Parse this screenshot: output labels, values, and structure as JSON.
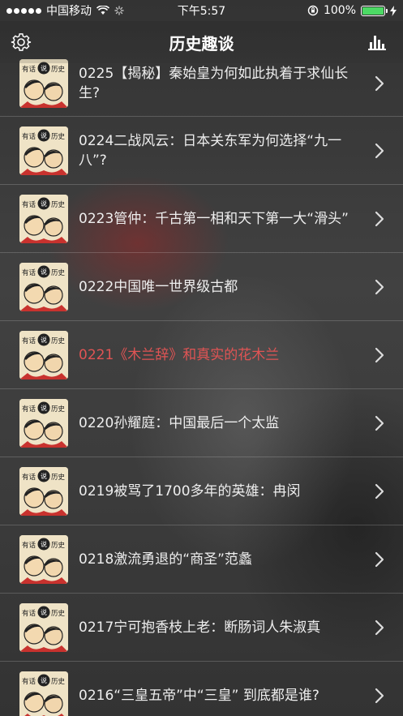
{
  "status_bar": {
    "carrier": "中国移动",
    "time": "下午5:57",
    "battery_percent": "100%",
    "battery_level": 1.0
  },
  "nav": {
    "title": "历史趣谈",
    "left_icon": "gear-icon",
    "right_icon": "bar-chart-icon"
  },
  "thumbnail": {
    "text_left": "有话",
    "text_badge": "说",
    "text_right": "历史"
  },
  "episodes": [
    {
      "title": "0225【揭秘】秦始皇为何如此执着于求仙长生?",
      "active": false
    },
    {
      "title": "0224二战风云：日本关东军为何选择“九一八”?",
      "active": false
    },
    {
      "title": "0223管仲：千古第一相和天下第一大“滑头”",
      "active": false
    },
    {
      "title": "0222中国唯一世界级古都",
      "active": false
    },
    {
      "title": "0221《木兰辞》和真实的花木兰",
      "active": true
    },
    {
      "title": "0220孙耀庭：中国最后一个太监",
      "active": false
    },
    {
      "title": "0219被骂了1700多年的英雄：冉闵",
      "active": false
    },
    {
      "title": "0218激流勇退的“商圣”范蠡",
      "active": false
    },
    {
      "title": "0217宁可抱香枝上老：断肠词人朱淑真",
      "active": false
    },
    {
      "title": "0216“三皇五帝”中“三皇” 到底都是谁?",
      "active": false
    }
  ],
  "colors": {
    "active_text": "#e05454",
    "battery_fill": "#4cd964"
  }
}
